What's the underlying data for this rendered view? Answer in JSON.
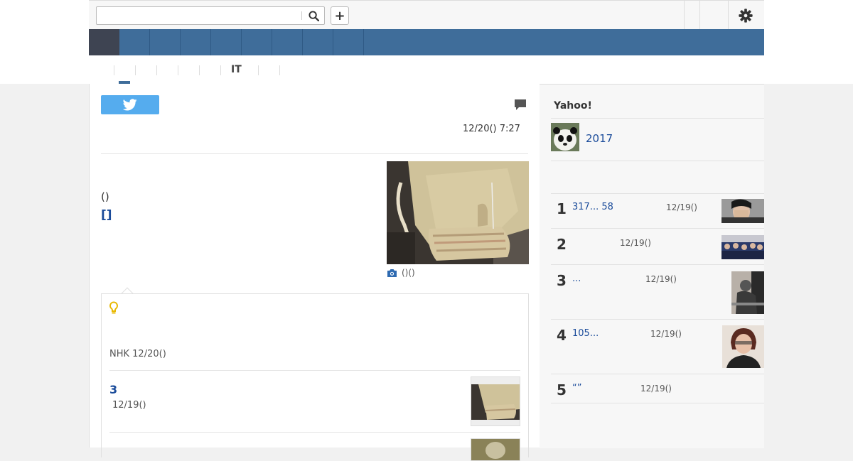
{
  "header": {
    "search_placeholder": "",
    "search_value": "",
    "search_icon": "search-icon",
    "add_icon": "plus-icon",
    "add_label": "+",
    "settings_icon": "gear-icon"
  },
  "subnav": {
    "it_label": "IT"
  },
  "article": {
    "share_icon": "twitter-icon",
    "comment_icon": "speech-bubble-icon",
    "date": "12/20() 7:27",
    "paren_text": "()",
    "bracket_link": "[]",
    "photo_caption": "()()",
    "camera_icon": "camera-icon"
  },
  "summary": {
    "bulb_icon": "lightbulb-icon",
    "source": "NHK 12/20()",
    "related": [
      {
        "title": "3",
        "date": "12/19()"
      }
    ]
  },
  "sidebar": {
    "title": "Yahoo!",
    "feature": {
      "text": "2017"
    },
    "ranking": [
      {
        "rank": "1",
        "title": "317... 58",
        "date": "12/19()"
      },
      {
        "rank": "2",
        "title": "",
        "date": "12/19()"
      },
      {
        "rank": "3",
        "title": "...",
        "date": "12/19()"
      },
      {
        "rank": "4",
        "title": "105...",
        "date": "12/19()"
      },
      {
        "rank": "5",
        "title": "“”",
        "date": "12/19()"
      }
    ]
  },
  "colors": {
    "nav": "#3f6d9a",
    "nav_home": "#3e4452",
    "link": "#1a4b9a",
    "twitter": "#55acee"
  }
}
